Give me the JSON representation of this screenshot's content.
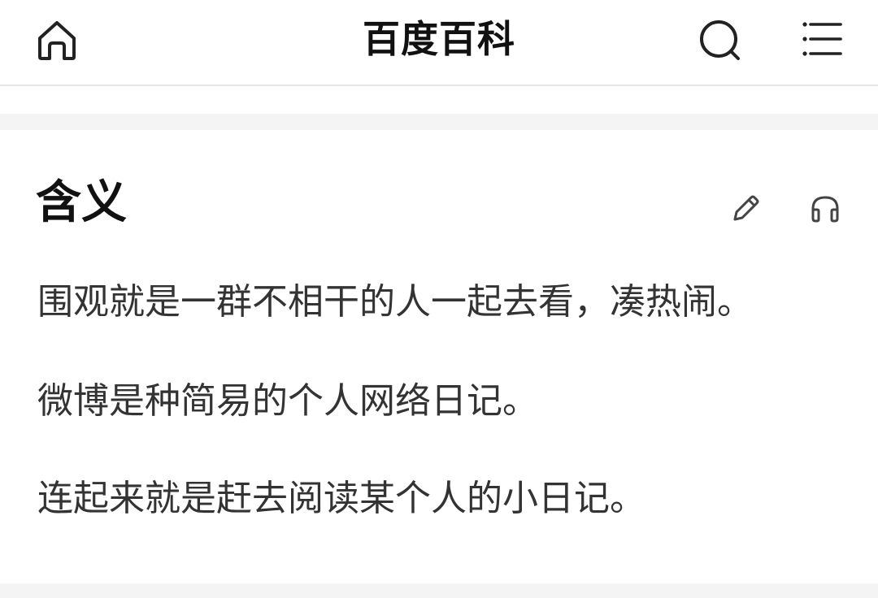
{
  "header": {
    "title": "百度百科",
    "home_icon": "home-icon",
    "search_icon": "search-icon",
    "menu_icon": "menu-icon"
  },
  "section": {
    "title": "含义",
    "edit_icon": "pencil-icon",
    "listen_icon": "headphones-icon",
    "paragraphs": [
      "围观就是一群不相干的人一起去看，凑热闹。",
      "微博是种简易的个人网络日记。",
      "连起来就是赶去阅读某个人的小日记。"
    ]
  },
  "colors": {
    "background": "#ffffff",
    "divider": "#f4f4f4",
    "title_text": "#111111",
    "body_text": "#333333",
    "icon": "#222222"
  }
}
